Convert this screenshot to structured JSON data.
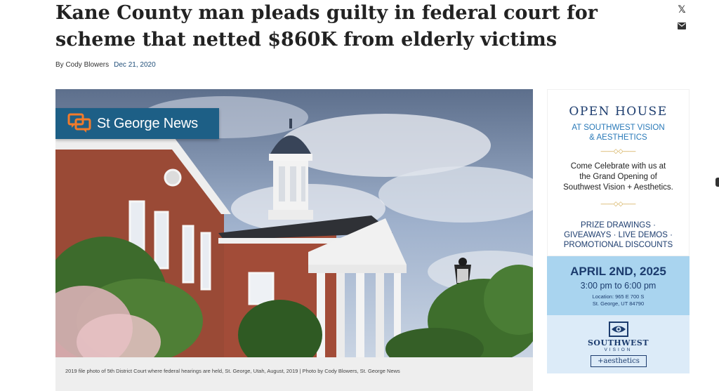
{
  "article": {
    "headline": "Kane County man pleads guilty in federal court for scheme that netted $860K from elderly victims",
    "byline": "By Cody Blowers",
    "date": "Dec 21, 2020",
    "photo_caption": "2019 file photo of 5th District Court where federal hearings are held, St. George, Utah, August, 2019 | Photo by Cody Blowers, St. George News",
    "photo_watermark": "St George News"
  },
  "share": {
    "x_glyph": "𝕏",
    "icons": [
      "x-share-icon",
      "email-share-icon"
    ]
  },
  "ad": {
    "title": "OPEN HOUSE",
    "subtitle_line1": "AT SOUTHWEST VISION",
    "subtitle_line2": "& AESTHETICS",
    "divider": "——◇◇——",
    "body_line1": "Come Celebrate with us at",
    "body_line2": "the Grand Opening of",
    "body_line3": "Southwest Vision + Aesthetics.",
    "list_line1": "PRIZE DRAWINGS ·",
    "list_line2": "GIVEAWAYS · LIVE DEMOS ·",
    "list_line3": "PROMOTIONAL DISCOUNTS",
    "event_date": "APRIL 2ND, 2025",
    "event_time": "3:00 pm to 6:00 pm",
    "location_line1": "Location: 965 E 700 S",
    "location_line2": "St. George, UT 84790",
    "brand_line1": "SOUTHWEST",
    "brand_line2": "VISION",
    "brand_line3": "+aesthetics"
  },
  "colors": {
    "brand_blue": "#1d5f86",
    "ad_navy": "#1c3c6e",
    "ad_light_blue": "#a9d4ef",
    "date_link": "#1f4e79"
  }
}
